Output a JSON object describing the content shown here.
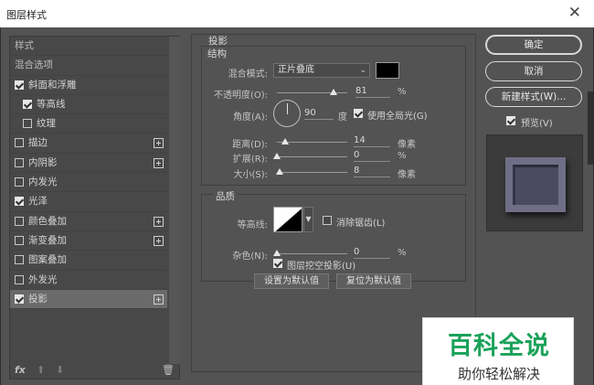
{
  "window": {
    "title": "图层样式",
    "close_icon": "close-icon"
  },
  "effects": {
    "items": [
      {
        "label": "样式",
        "type": "header"
      },
      {
        "label": "混合选项",
        "type": "header"
      },
      {
        "label": "斜面和浮雕",
        "checked": true
      },
      {
        "label": "等高线",
        "checked": true,
        "indent": true
      },
      {
        "label": "纹理",
        "checked": false,
        "indent": true
      },
      {
        "label": "描边",
        "checked": false,
        "plus": true
      },
      {
        "label": "内阴影",
        "checked": false,
        "plus": true
      },
      {
        "label": "内发光",
        "checked": false
      },
      {
        "label": "光泽",
        "checked": true
      },
      {
        "label": "颜色叠加",
        "checked": false,
        "plus": true
      },
      {
        "label": "渐变叠加",
        "checked": false,
        "plus": true
      },
      {
        "label": "图案叠加",
        "checked": false
      },
      {
        "label": "外发光",
        "checked": false
      },
      {
        "label": "投影",
        "checked": true,
        "plus": true,
        "selected": true
      }
    ],
    "tools": {
      "fx": "fx",
      "up": "⬆",
      "down": "⬇",
      "trash": "🗑"
    }
  },
  "shadow": {
    "section_title": "投影",
    "structure_title": "结构",
    "blend_mode_label": "混合模式:",
    "blend_mode_value": "正片叠底",
    "blend_color": "#000000",
    "opacity_label": "不透明度(O):",
    "opacity_value": "81",
    "opacity_unit": "%",
    "opacity_level": 0.81,
    "angle_label": "角度(A):",
    "angle_value": "90",
    "angle_unit": "度",
    "global_light_label": "使用全局光(G)",
    "global_light_checked": true,
    "distance_label": "距离(D):",
    "distance_value": "14",
    "distance_unit": "像素",
    "spread_label": "扩展(R):",
    "spread_value": "0",
    "spread_unit": "%",
    "size_label": "大小(S):",
    "size_value": "8",
    "size_unit": "像素",
    "quality_title": "品质",
    "contour_label": "等高线:",
    "antialias_label": "消除锯齿(L)",
    "antialias_checked": false,
    "noise_label": "杂色(N):",
    "noise_value": "0",
    "noise_unit": "%",
    "knockout_label": "图层挖空投影(U)",
    "knockout_checked": true,
    "set_default_label": "设置为默认值",
    "reset_default_label": "复位为默认值"
  },
  "buttons": {
    "ok": "确定",
    "cancel": "取消",
    "new_style": "新建样式(W)...",
    "preview_label": "预览(V)",
    "preview_checked": true
  },
  "watermark": {
    "title": "百科全说",
    "subtitle": "助你轻松解决"
  }
}
